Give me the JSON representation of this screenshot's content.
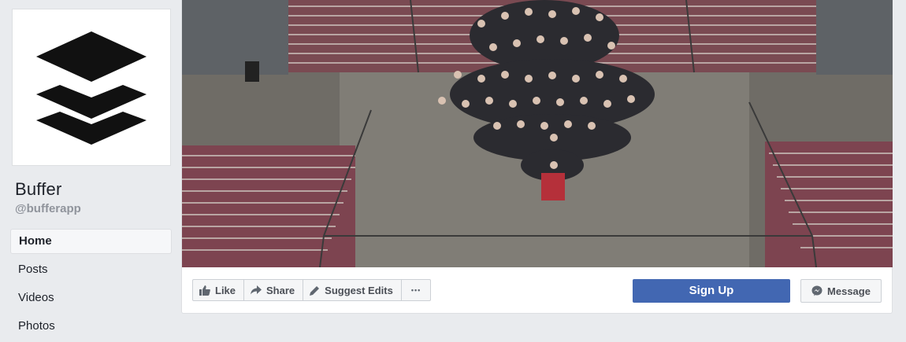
{
  "page": {
    "name": "Buffer",
    "handle": "@bufferapp"
  },
  "nav": {
    "items": [
      {
        "label": "Home",
        "active": true
      },
      {
        "label": "Posts",
        "active": false
      },
      {
        "label": "Videos",
        "active": false
      },
      {
        "label": "Photos",
        "active": false
      }
    ]
  },
  "actions": {
    "like_label": "Like",
    "share_label": "Share",
    "suggest_label": "Suggest Edits",
    "more_label": "•••",
    "signup_label": "Sign Up",
    "message_label": "Message"
  },
  "colors": {
    "primary": "#4267b2",
    "background": "#e9ebee",
    "logo": "#111111"
  },
  "icons": [
    "buffer-logo",
    "thumbs-up-icon",
    "share-arrow-icon",
    "pencil-icon",
    "more-dots-icon",
    "messenger-icon"
  ]
}
